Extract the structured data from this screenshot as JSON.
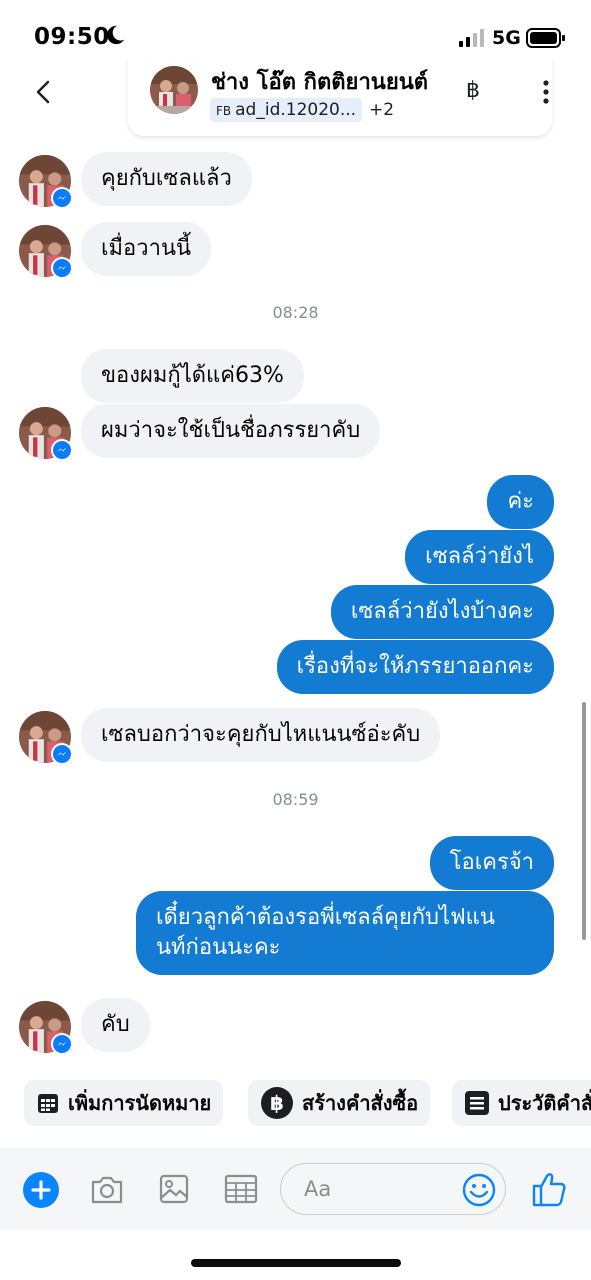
{
  "status_bar": {
    "time": "09:50",
    "network": "5G"
  },
  "header": {
    "contact_name": "ช่าง โอ๊ต กิตติยานยนต์",
    "ad_chip_prefix": "FB",
    "ad_chip_label": "ad_id.12020...",
    "more_count": "+2",
    "currency_symbol": "฿"
  },
  "messages": [
    {
      "direction": "in",
      "text": "คุยกับเซลแล้ว"
    },
    {
      "direction": "in",
      "text": "เมื่อวานนี้"
    },
    {
      "type": "timestamp",
      "text": "08:28"
    },
    {
      "direction": "in",
      "text": "ของผมกู้ได้แค่63%"
    },
    {
      "direction": "in",
      "text": "ผมว่าจะใช้เป็นชื่อภรรยาคับ"
    },
    {
      "direction": "out",
      "text": "ค่ะ"
    },
    {
      "direction": "out",
      "text": "เซลล์ว่ายังไ"
    },
    {
      "direction": "out",
      "text": "เซลล์ว่ายังไงบ้างคะ"
    },
    {
      "direction": "out",
      "text": "เรื่องที่จะให้ภรรยาออกคะ"
    },
    {
      "direction": "in",
      "text": "เซลบอกว่าจะคุยกับไหแนนซ์อ่ะคับ"
    },
    {
      "type": "timestamp",
      "text": "08:59"
    },
    {
      "direction": "out",
      "text": "โอเครจ้า"
    },
    {
      "direction": "out",
      "text_line1": "เดี๋ยวลูกค้าต้องรอพี่เซลล์คุยกับไฟแน",
      "text_line2": "นท์ก่อนนะคะ"
    },
    {
      "direction": "in",
      "text": "คับ"
    }
  ],
  "quick_actions": [
    {
      "label": "เพิ่มการนัดหมาย",
      "icon": "calendar-icon"
    },
    {
      "label": "สร้างคำสั่งซื้อ",
      "icon": "baht-coin-icon"
    },
    {
      "label": "ประวัติคำสั่งซื้อ",
      "icon": "list-icon"
    }
  ],
  "composer": {
    "placeholder": "Aa"
  },
  "colors": {
    "outgoing_bubble": "#137bd1",
    "incoming_bubble": "#f0f2f5",
    "accent": "#0a84ff"
  }
}
